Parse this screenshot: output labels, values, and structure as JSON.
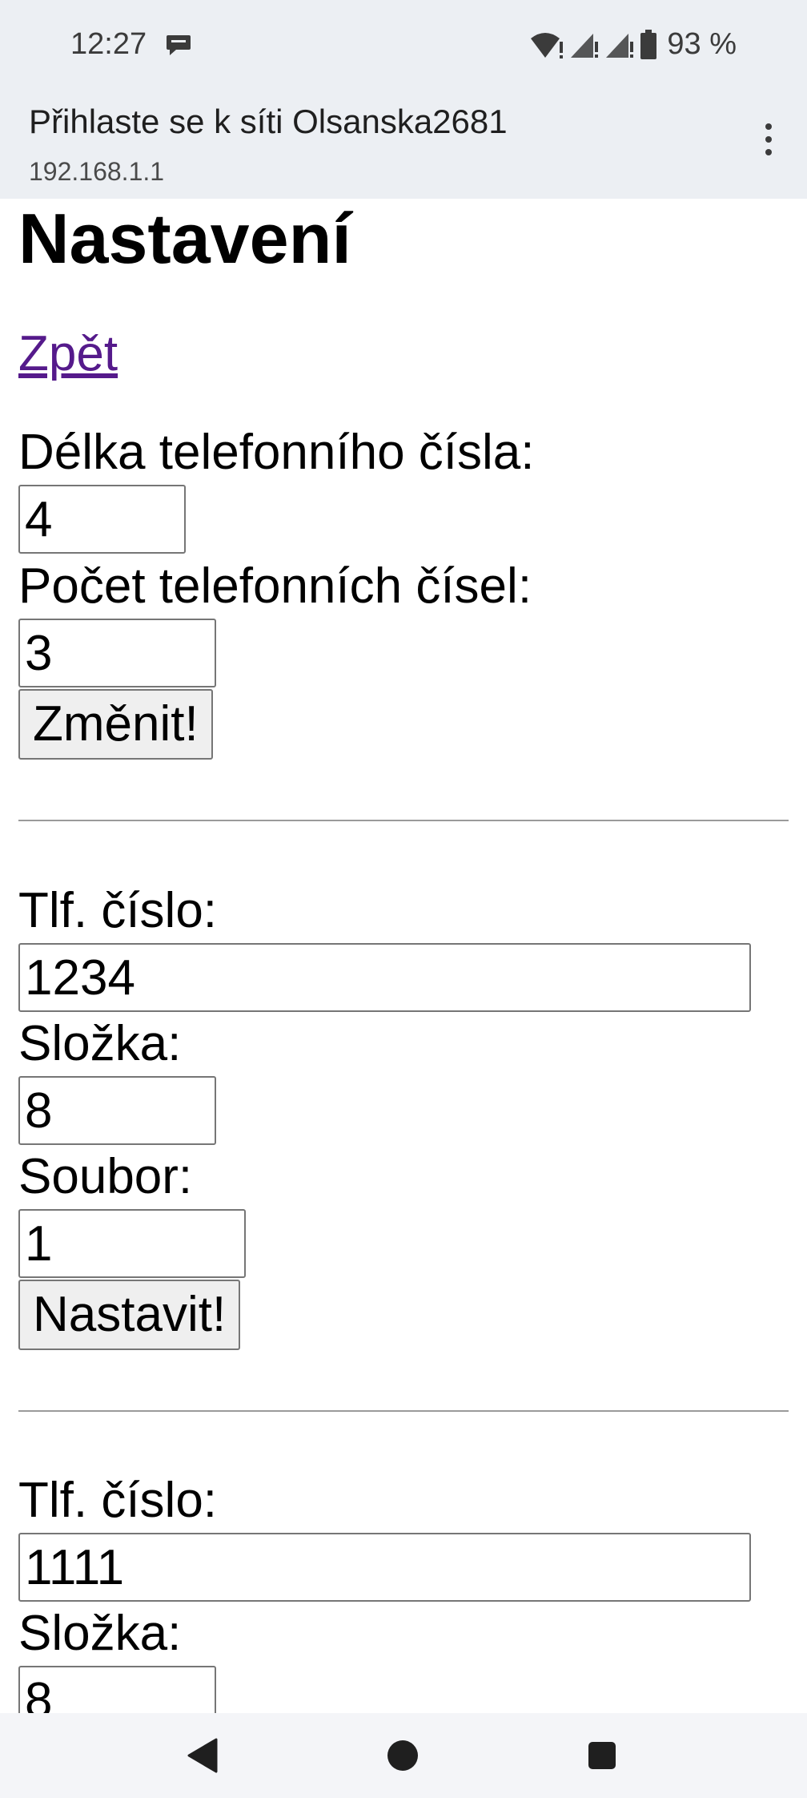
{
  "status_bar": {
    "time": "12:27",
    "battery": "93 %",
    "icons": [
      "chat-bubble-icon",
      "wifi-alert-icon",
      "signal-icon",
      "signal-icon",
      "battery-icon"
    ]
  },
  "header": {
    "title": "Přihlaste se k síti Olsanska2681",
    "url": "192.168.1.1"
  },
  "page": {
    "heading": "Nastavení",
    "back_link": "Zpět",
    "settings": {
      "length_label": "Délka telefonního čísla:",
      "length_value": "4",
      "count_label": "Počet telefonních čísel:",
      "count_value": "3",
      "change_button": "Změnit!"
    },
    "entries": [
      {
        "phone_label": "Tlf. číslo:",
        "phone_value": "1234",
        "folder_label": "Složka:",
        "folder_value": "8",
        "file_label": "Soubor:",
        "file_value": "1",
        "set_button": "Nastavit!"
      },
      {
        "phone_label": "Tlf. číslo:",
        "phone_value": "1111",
        "folder_label": "Složka:",
        "folder_value": "8"
      }
    ]
  },
  "colors": {
    "link": "#551a8b",
    "topbar": "#eceff3",
    "button_bg": "#efefef"
  }
}
